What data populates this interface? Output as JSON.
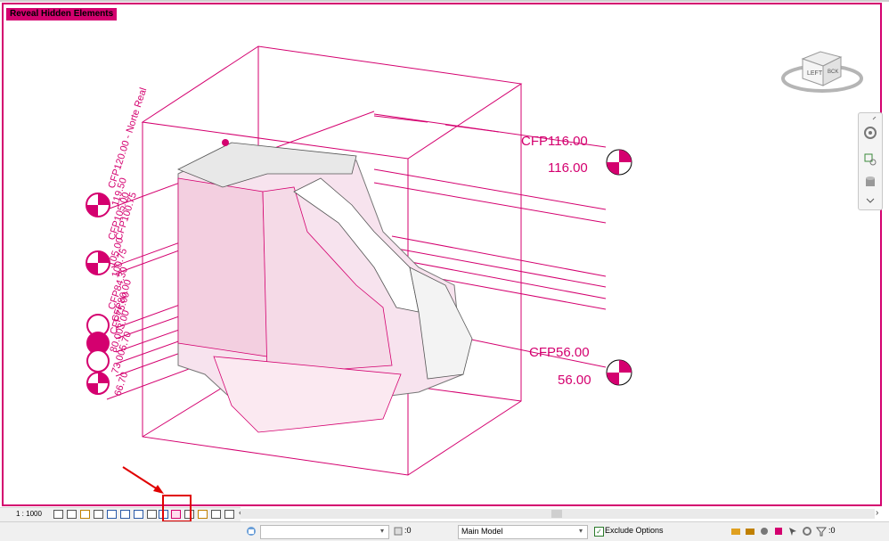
{
  "viewport": {
    "mode_label": "Reveal Hidden Elements",
    "accent_color": "#d4006f"
  },
  "viewcube": {
    "face_left": "LEFT",
    "face_back": "BCK"
  },
  "levels_left": {
    "l1": "CFP120.00 - Norte Real",
    "l1b": "119.50",
    "l2": "CFP105.00",
    "l3": "CFP100.75",
    "l4": "105.00",
    "l5": "100.75",
    "l6": "CFP84.30",
    "l7": "CFP80.00",
    "l8": "CFP75.00",
    "l9": "80.003.00",
    "l10": "73.005.70",
    "l11": "66.70"
  },
  "levels_right": {
    "top_name": "CFP116.00",
    "top_value": "116.00",
    "bottom_name": "CFP56.00",
    "bottom_value": "56.00"
  },
  "view_control_bar": {
    "scale": "1 : 1000",
    "icons": [
      "detail-level-icon",
      "visual-style-icon",
      "sun-path-icon",
      "shadows-icon",
      "render-icon",
      "crop-view-icon",
      "show-crop-icon",
      "unlock-3d-icon",
      "temporary-hide-icon",
      "reveal-hidden-icon",
      "temporary-view-properties-icon",
      "show-analytical-icon",
      "highlight-displacement-icon"
    ]
  },
  "status_bar": {
    "workset_value": "",
    "count": ":0",
    "design_option": "Main Model",
    "exclude_options_label": "Exclude Options",
    "filter_count": ":0"
  }
}
